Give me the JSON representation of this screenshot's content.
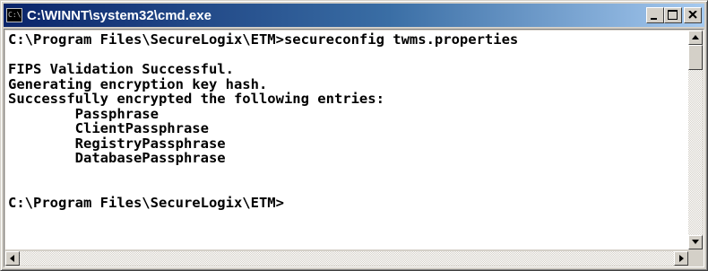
{
  "window": {
    "title": "C:\\WINNT\\system32\\cmd.exe",
    "icon": "console-icon",
    "icon_glyph": "C:\\",
    "buttons": [
      "minimize-icon",
      "maximize-icon",
      "close-icon"
    ]
  },
  "console": {
    "lines": [
      "C:\\Program Files\\SecureLogix\\ETM>secureconfig twms.properties",
      "",
      "FIPS Validation Successful.",
      "Generating encryption key hash.",
      "Successfully encrypted the following entries:",
      "        Passphrase",
      "        ClientPassphrase",
      "        RegistryPassphrase",
      "        DatabasePassphrase",
      "",
      "",
      "C:\\Program Files\\SecureLogix\\ETM>"
    ]
  },
  "scrollbars": {
    "vertical": {
      "up_icon": "arrow-up-icon",
      "down_icon": "arrow-down-icon"
    },
    "horizontal": {
      "left_icon": "arrow-left-icon",
      "right_icon": "arrow-right-icon"
    }
  },
  "colors": {
    "titlebar_start": "#0a246a",
    "titlebar_end": "#a6caf0",
    "console_bg": "#ffffff",
    "console_text": "#000000",
    "chrome": "#d4d0c8"
  }
}
